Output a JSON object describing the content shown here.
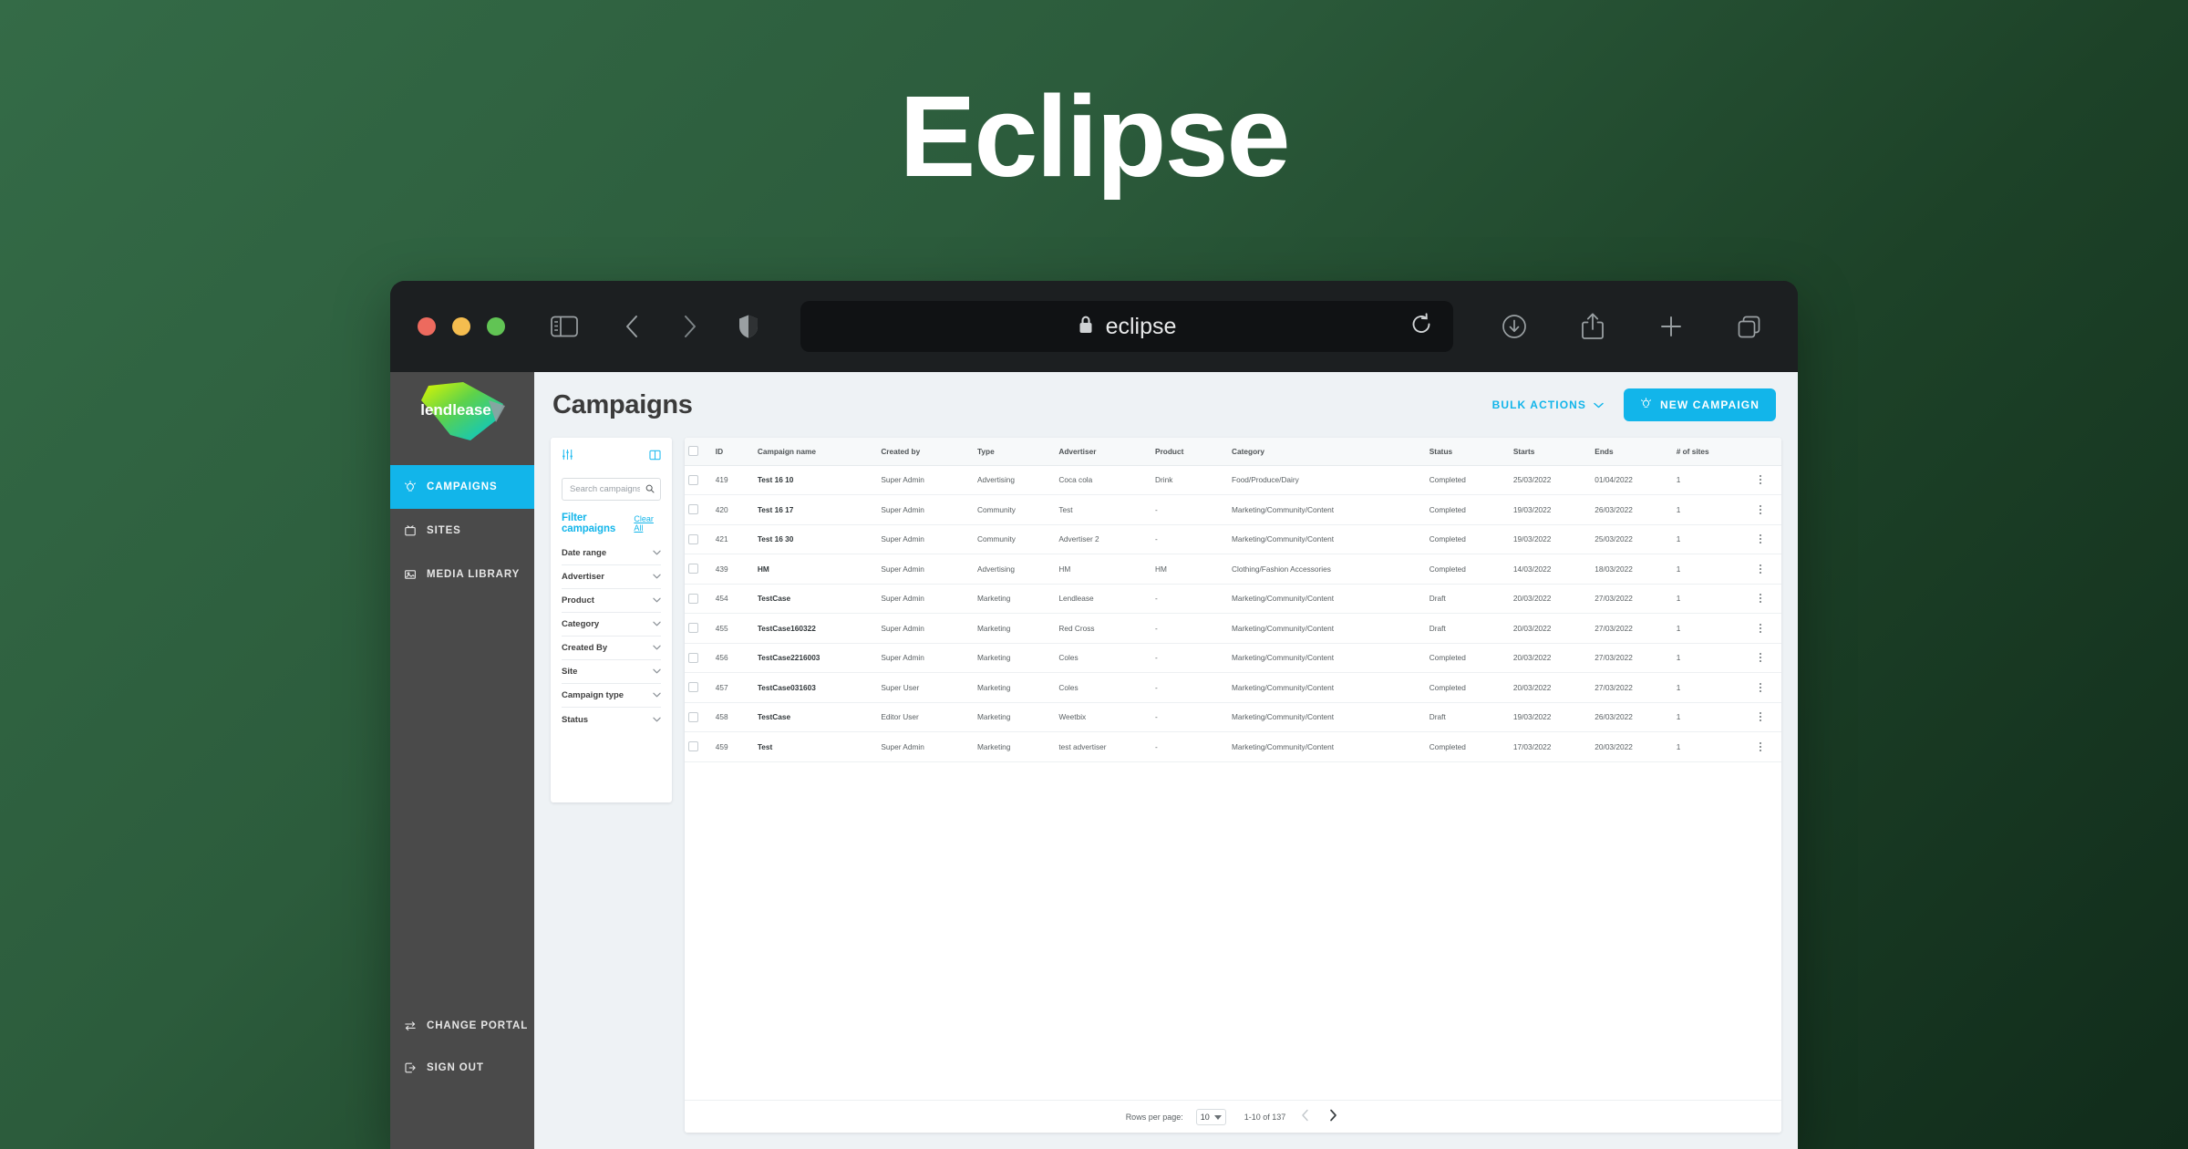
{
  "hero": {
    "title": "Eclipse"
  },
  "browser": {
    "traffic_lights": [
      "close",
      "minimize",
      "maximize"
    ],
    "url_text": "eclipse",
    "lock_icon": "lock-icon",
    "reload_icon": "reload-icon",
    "sidebar_icon": "sidebar-toggle-icon",
    "back_icon": "back-chevron-icon",
    "forward_icon": "forward-chevron-icon",
    "shield_icon": "shield-icon",
    "download_icon": "download-icon",
    "share_icon": "share-icon",
    "newtab_icon": "plus-icon",
    "tabs_icon": "tab-overview-icon"
  },
  "sidebar": {
    "logo_text": "lendlease",
    "items": [
      {
        "label": "CAMPAIGNS",
        "icon": "lightbulb-icon",
        "active": true
      },
      {
        "label": "SITES",
        "icon": "screen-icon",
        "active": false
      },
      {
        "label": "MEDIA LIBRARY",
        "icon": "image-icon",
        "active": false
      }
    ],
    "bottom_items": [
      {
        "label": "CHANGE PORTAL",
        "icon": "swap-arrows-icon"
      },
      {
        "label": "SIGN OUT",
        "icon": "sign-out-icon"
      }
    ]
  },
  "header": {
    "title": "Campaigns",
    "bulk_actions_label": "BULK ACTIONS",
    "new_campaign_label": "NEW CAMPAIGN"
  },
  "filters": {
    "panel_icon": "filter-sliders-icon",
    "layout_icon": "panel-layout-icon",
    "search_placeholder": "Search campaigns",
    "search_value": "",
    "title": "Filter campaigns",
    "clear_all_label": "Clear All",
    "groups": [
      {
        "label": "Date range"
      },
      {
        "label": "Advertiser"
      },
      {
        "label": "Product"
      },
      {
        "label": "Category"
      },
      {
        "label": "Created By"
      },
      {
        "label": "Site"
      },
      {
        "label": "Campaign type"
      },
      {
        "label": "Status"
      }
    ]
  },
  "table": {
    "columns": [
      "ID",
      "Campaign name",
      "Created by",
      "Type",
      "Advertiser",
      "Product",
      "Category",
      "Status",
      "Starts",
      "Ends",
      "# of sites"
    ],
    "rows": [
      {
        "id": "419",
        "name": "Test 16 10",
        "created_by": "Super Admin",
        "type": "Advertising",
        "advertiser": "Coca cola",
        "product": "Drink",
        "category": "Food/Produce/Dairy",
        "status": "Completed",
        "starts": "25/03/2022",
        "ends": "01/04/2022",
        "sites": "1"
      },
      {
        "id": "420",
        "name": "Test 16 17",
        "created_by": "Super Admin",
        "type": "Community",
        "advertiser": "Test",
        "product": "-",
        "category": "Marketing/Community/Content",
        "status": "Completed",
        "starts": "19/03/2022",
        "ends": "26/03/2022",
        "sites": "1"
      },
      {
        "id": "421",
        "name": "Test 16 30",
        "created_by": "Super Admin",
        "type": "Community",
        "advertiser": "Advertiser 2",
        "product": "-",
        "category": "Marketing/Community/Content",
        "status": "Completed",
        "starts": "19/03/2022",
        "ends": "25/03/2022",
        "sites": "1"
      },
      {
        "id": "439",
        "name": "HM",
        "created_by": "Super Admin",
        "type": "Advertising",
        "advertiser": "HM",
        "product": "HM",
        "category": "Clothing/Fashion Accessories",
        "status": "Completed",
        "starts": "14/03/2022",
        "ends": "18/03/2022",
        "sites": "1"
      },
      {
        "id": "454",
        "name": "TestCase",
        "created_by": "Super Admin",
        "type": "Marketing",
        "advertiser": "Lendlease",
        "product": "-",
        "category": "Marketing/Community/Content",
        "status": "Draft",
        "starts": "20/03/2022",
        "ends": "27/03/2022",
        "sites": "1"
      },
      {
        "id": "455",
        "name": "TestCase160322",
        "created_by": "Super Admin",
        "type": "Marketing",
        "advertiser": "Red Cross",
        "product": "-",
        "category": "Marketing/Community/Content",
        "status": "Draft",
        "starts": "20/03/2022",
        "ends": "27/03/2022",
        "sites": "1"
      },
      {
        "id": "456",
        "name": "TestCase2216003",
        "created_by": "Super Admin",
        "type": "Marketing",
        "advertiser": "Coles",
        "product": "-",
        "category": "Marketing/Community/Content",
        "status": "Completed",
        "starts": "20/03/2022",
        "ends": "27/03/2022",
        "sites": "1"
      },
      {
        "id": "457",
        "name": "TestCase031603",
        "created_by": "Super User",
        "type": "Marketing",
        "advertiser": "Coles",
        "product": "-",
        "category": "Marketing/Community/Content",
        "status": "Completed",
        "starts": "20/03/2022",
        "ends": "27/03/2022",
        "sites": "1"
      },
      {
        "id": "458",
        "name": "TestCase",
        "created_by": "Editor User",
        "type": "Marketing",
        "advertiser": "Weetbix",
        "product": "-",
        "category": "Marketing/Community/Content",
        "status": "Draft",
        "starts": "19/03/2022",
        "ends": "26/03/2022",
        "sites": "1"
      },
      {
        "id": "459",
        "name": "Test",
        "created_by": "Super Admin",
        "type": "Marketing",
        "advertiser": "test advertiser",
        "product": "-",
        "category": "Marketing/Community/Content",
        "status": "Completed",
        "starts": "17/03/2022",
        "ends": "20/03/2022",
        "sites": "1"
      }
    ]
  },
  "pagination": {
    "rows_per_page_label": "Rows per page:",
    "rows_per_page_value": "10",
    "range_text": "1-10 of 137",
    "prev_icon": "chevron-left-icon",
    "next_icon": "chevron-right-icon"
  },
  "colors": {
    "accent": "#12b5ea",
    "nav_bg": "#4a4a4a",
    "app_bg": "#eef2f5",
    "bg_gradient_start": "#346b47",
    "bg_gradient_end": "#112c1b"
  }
}
